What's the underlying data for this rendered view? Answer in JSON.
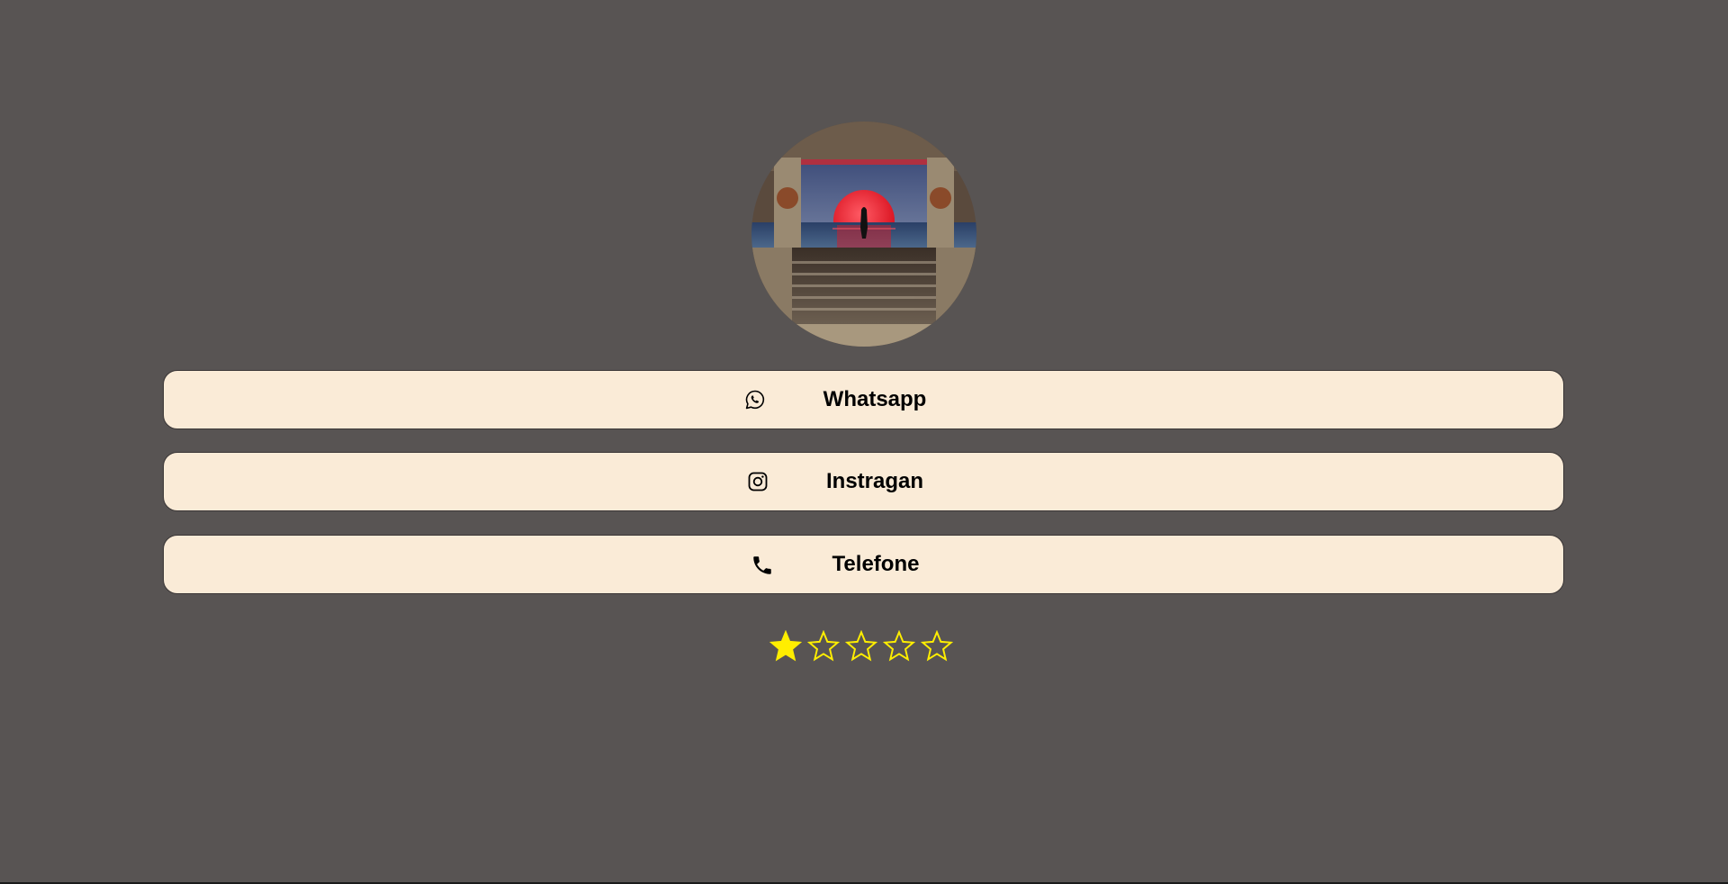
{
  "profile": {
    "avatar_icon": "profile-photo-red-moon-over-sea"
  },
  "links": [
    {
      "label": "Whatsapp",
      "icon": "whatsapp-icon"
    },
    {
      "label": "Instragan",
      "icon": "instagram-icon"
    },
    {
      "label": "Telefone",
      "icon": "phone-icon"
    }
  ],
  "rating": {
    "value": 1,
    "max": 5,
    "star_color": "#ffee00"
  },
  "colors": {
    "background": "#585453",
    "button_background": "#faebd7"
  }
}
